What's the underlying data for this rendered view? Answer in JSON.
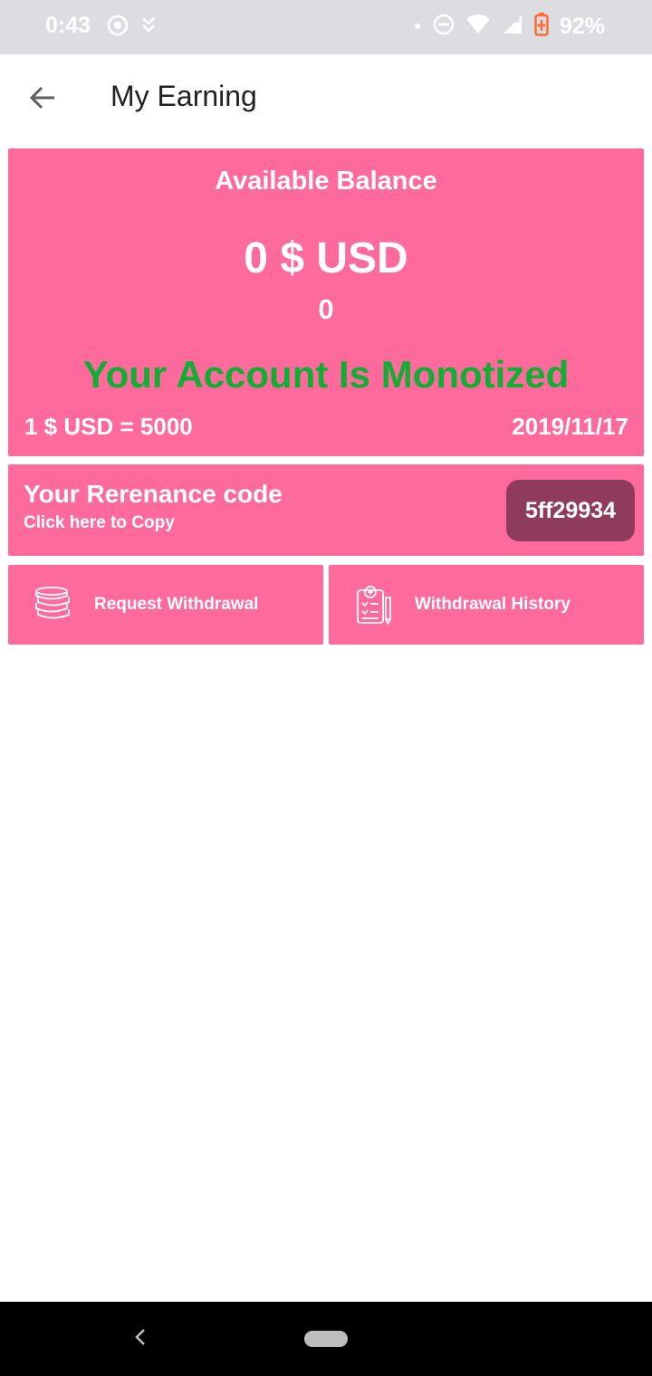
{
  "status_bar": {
    "time": "0:43",
    "battery": "92%",
    "icons": [
      "vpn-icon",
      "download-icon",
      "dot-icon",
      "dnd-icon",
      "wifi-icon",
      "signal-icon",
      "battery-charging-icon"
    ]
  },
  "app_bar": {
    "title": "My Earning",
    "back_icon": "arrow-left-icon"
  },
  "balance": {
    "label": "Available Balance",
    "amount": "0 $ USD",
    "points": "0",
    "status": "Your Account Is Monotized",
    "rate": "1 $ USD = 5000",
    "date": "2019/11/17"
  },
  "referral": {
    "title": "Your Rerenance code",
    "subtitle": "Click here to Copy",
    "code": "5ff29934"
  },
  "actions": [
    {
      "label": "Request Withdrawal",
      "icon": "coins-icon"
    },
    {
      "label": "Withdrawal History",
      "icon": "clipboard-icon"
    }
  ],
  "colors": {
    "card": "#ff6a9c",
    "code_badge": "#8f3b5b",
    "status_green": "#11ad34",
    "status_bar": "#dcdde1"
  }
}
